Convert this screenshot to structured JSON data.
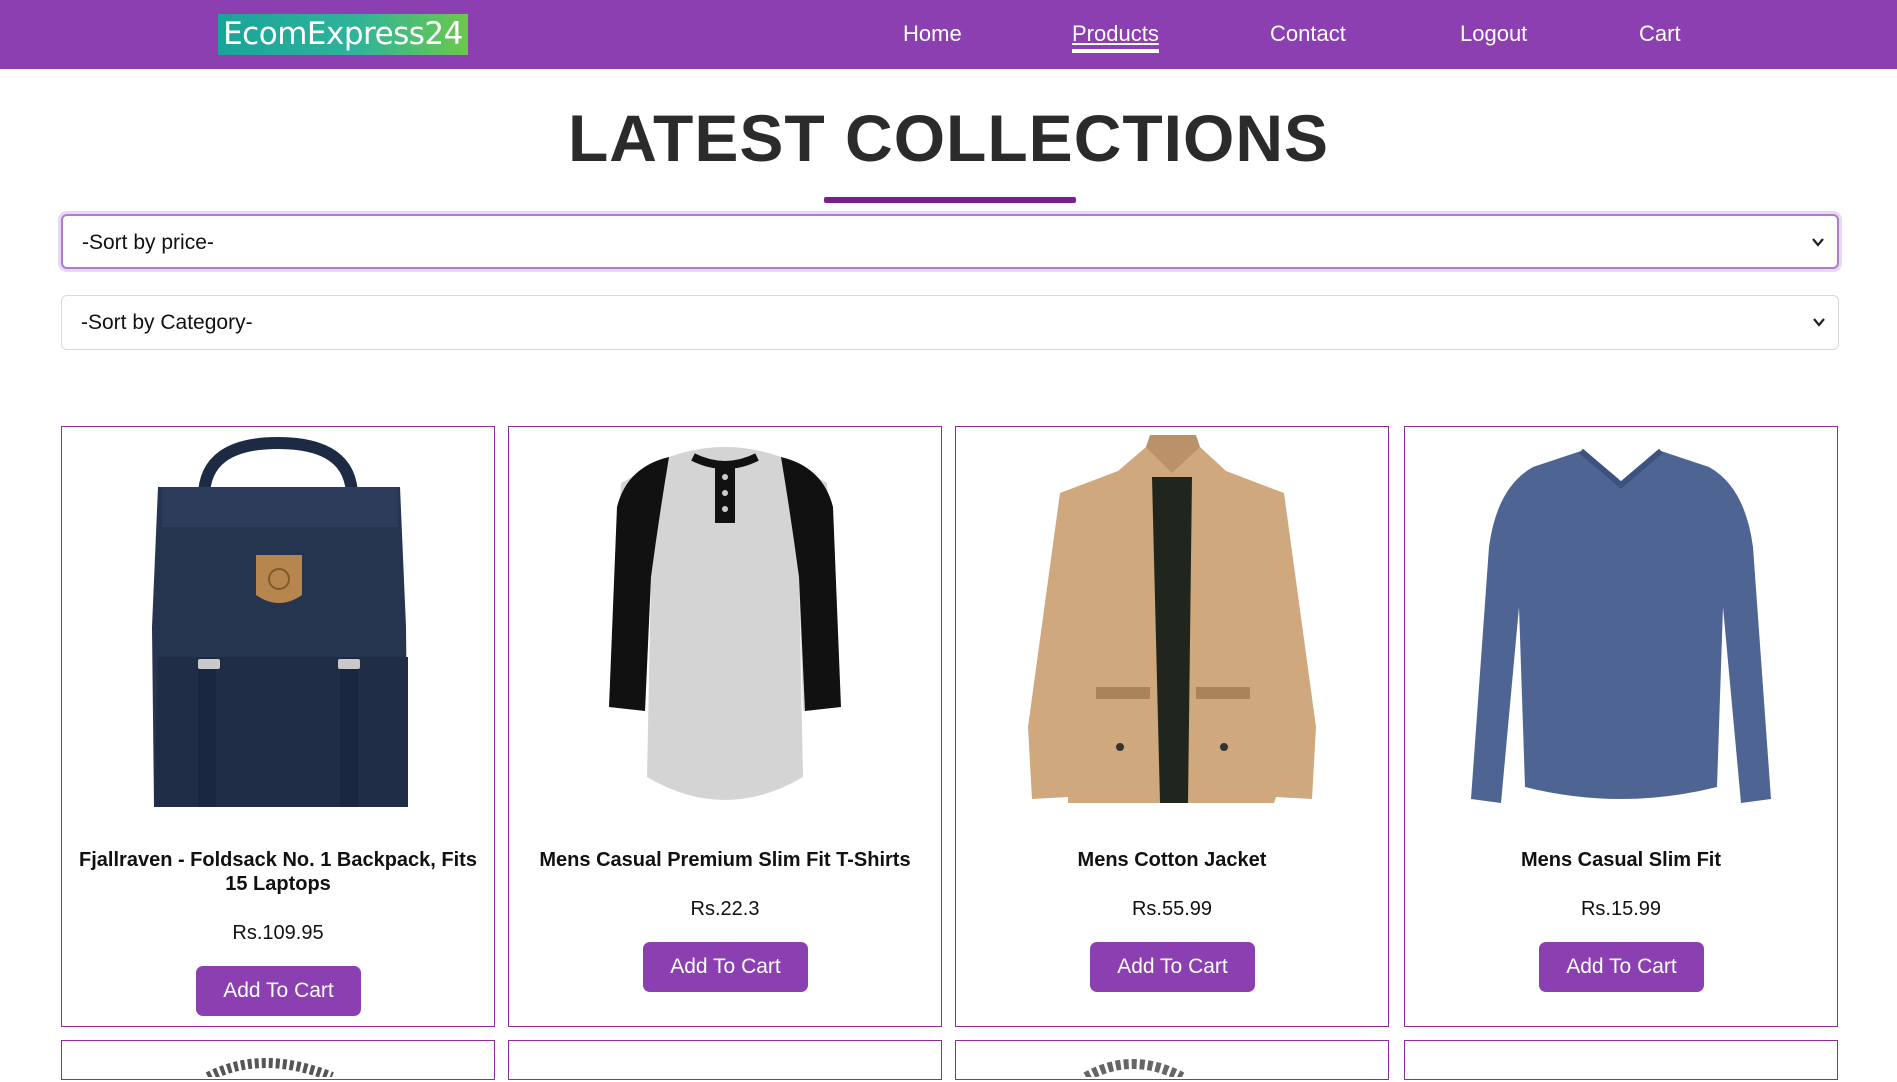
{
  "nav": {
    "logo": "EcomExpress24",
    "links": [
      "Home",
      "Products",
      "Contact",
      "Logout",
      "Cart"
    ]
  },
  "main": {
    "title": "LATEST COLLECTIONS",
    "sort_price": "-Sort by price-",
    "sort_category": "-Sort by Category-"
  },
  "products": [
    {
      "name": "Fjallraven - Foldsack No. 1 Backpack, Fits 15 Laptops",
      "price": "Rs.109.95",
      "button": "Add To Cart",
      "image": "navy-backpack"
    },
    {
      "name": "Mens Casual Premium Slim Fit T-Shirts",
      "price": "Rs.22.3",
      "button": "Add To Cart",
      "image": "raglan-henley-tshirt"
    },
    {
      "name": "Mens Cotton Jacket",
      "price": "Rs.55.99",
      "button": "Add To Cart",
      "image": "khaki-cotton-jacket"
    },
    {
      "name": "Mens Casual Slim Fit",
      "price": "Rs.15.99",
      "button": "Add To Cart",
      "image": "blue-long-sleeve-shirt"
    }
  ],
  "colors": {
    "nav_bg": "#8b3fb0",
    "accent": "#7a1e8e",
    "button": "#8b3fb0",
    "card_border": "#8e2c9a"
  }
}
